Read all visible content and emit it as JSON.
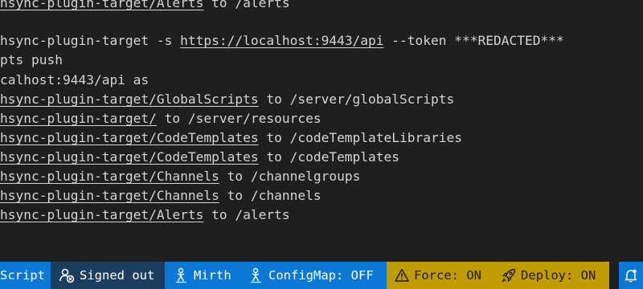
{
  "terminal": {
    "lines": [
      {
        "prefix": "",
        "link": "hsync-plugin-target/Alerts",
        "suffix": " to /alerts"
      },
      {
        "prefix": "hsync-plugin-target -s ",
        "link": "https://localhost:9443/api",
        "suffix": " --token ***REDACTED***"
      },
      {
        "prefix": "pts push",
        "link": "",
        "suffix": ""
      },
      {
        "prefix": "calhost:9443/api as",
        "link": "",
        "suffix": ""
      },
      {
        "prefix": "",
        "link": "hsync-plugin-target/GlobalScripts",
        "suffix": " to /server/globalScripts"
      },
      {
        "prefix": "",
        "link": "hsync-plugin-target/",
        "suffix": " to /server/resources"
      },
      {
        "prefix": "",
        "link": "hsync-plugin-target/CodeTemplates",
        "suffix": " to /codeTemplateLibraries"
      },
      {
        "prefix": "",
        "link": "hsync-plugin-target/CodeTemplates",
        "suffix": " to /codeTemplates"
      },
      {
        "prefix": "",
        "link": "hsync-plugin-target/Channels",
        "suffix": " to /channelgroups"
      },
      {
        "prefix": "",
        "link": "hsync-plugin-target/Channels",
        "suffix": " to /channels"
      },
      {
        "prefix": "",
        "link": "hsync-plugin-target/Alerts",
        "suffix": " to /alerts"
      }
    ]
  },
  "statusbar": {
    "script_label": "Script",
    "signed_out_label": "Signed out",
    "mirth_label": "Mirth",
    "configmap_label": "ConfigMap: OFF",
    "force_label": "Force: ON",
    "deploy_label": "Deploy: ON",
    "icons": {
      "signed_out": "account-signed-out-icon",
      "mirth": "mirth-icon",
      "configmap": "configmap-icon",
      "force": "warning-icon",
      "deploy": "rocket-icon",
      "notifications": "bell-icon"
    }
  }
}
